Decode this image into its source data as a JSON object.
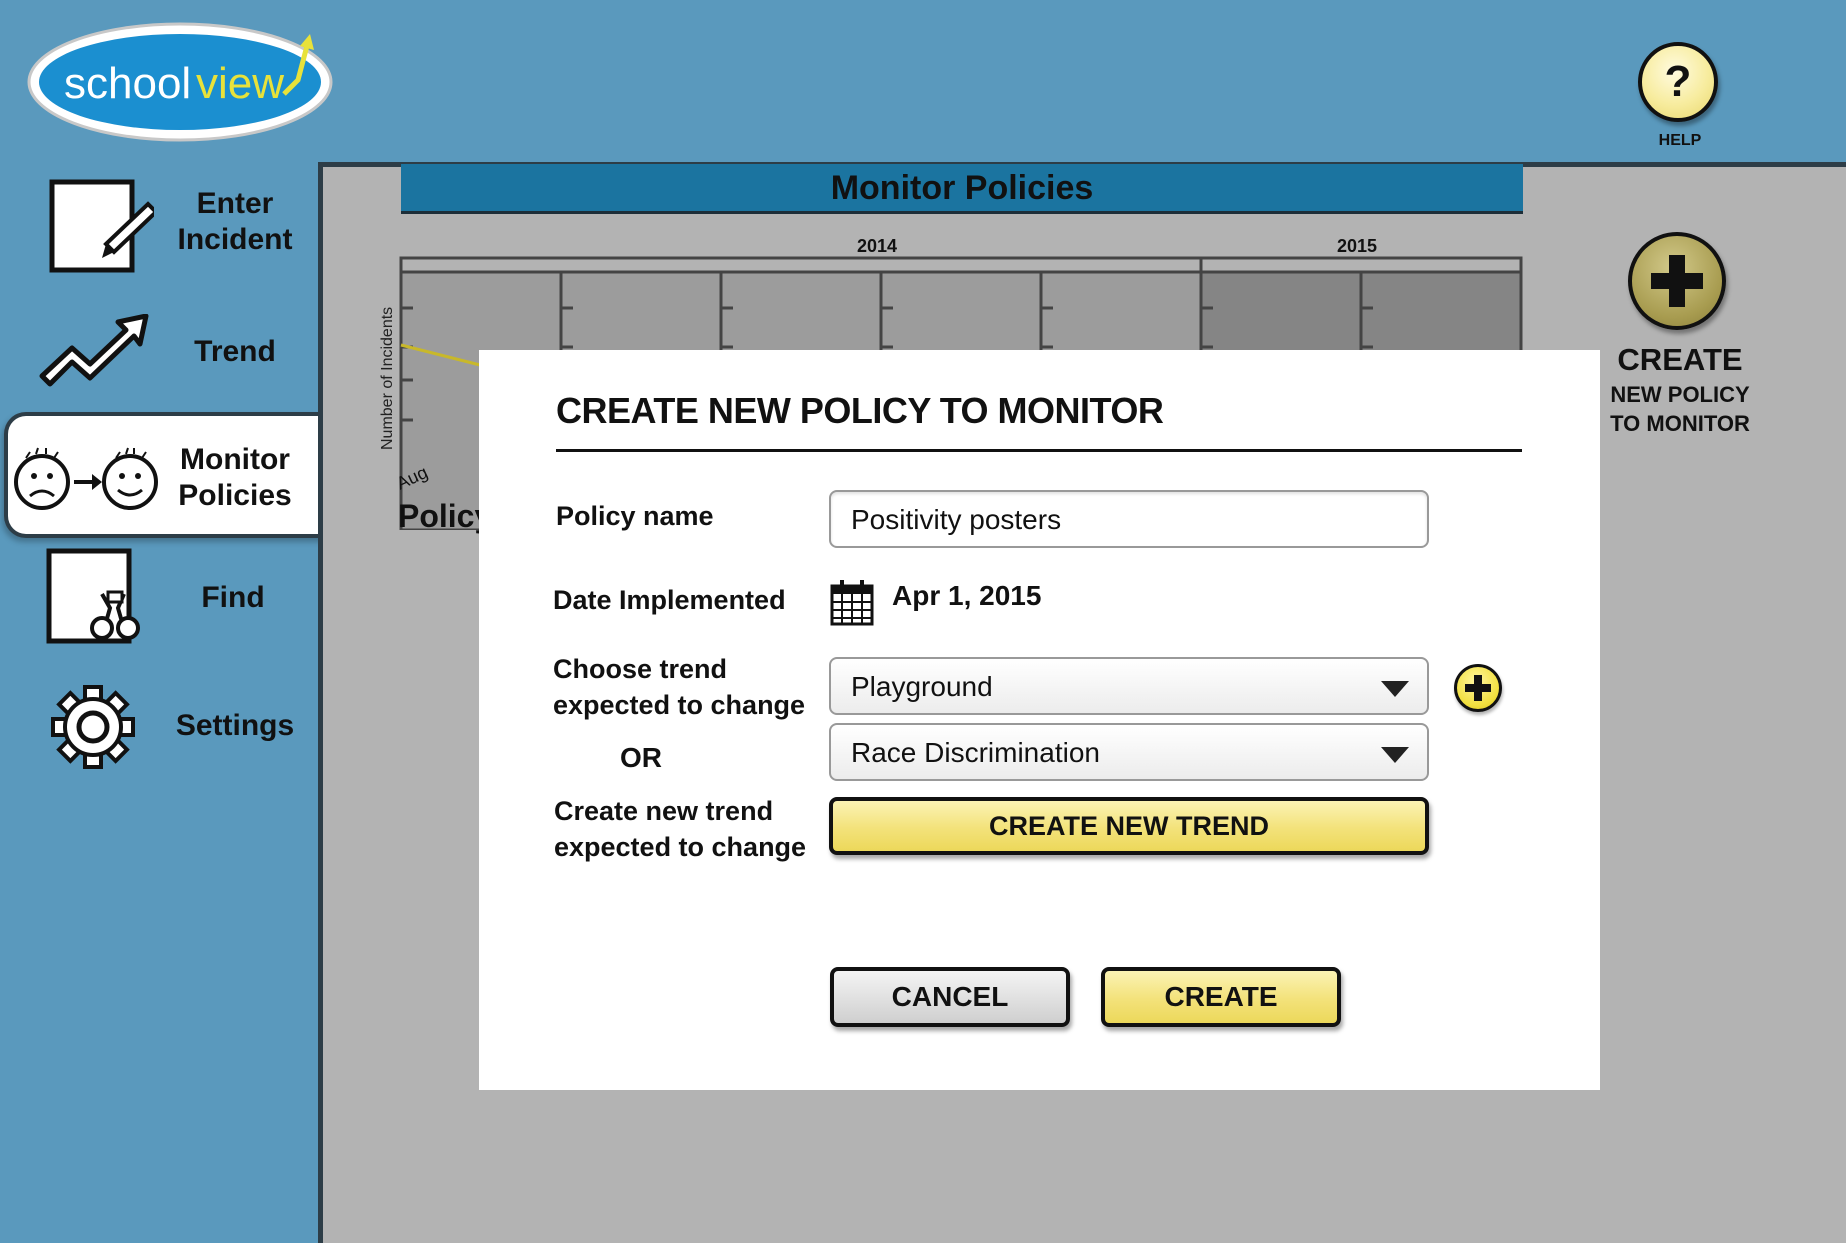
{
  "app": {
    "logo_text_school": "school",
    "logo_text_view": "view"
  },
  "help": {
    "label": "HELP",
    "glyph": "?"
  },
  "sidebar": {
    "items": [
      {
        "label_line1": "Enter",
        "label_line2": "Incident",
        "icon": "pencil-note-icon"
      },
      {
        "label_line1": "Trend",
        "label_line2": "",
        "icon": "trend-arrow-icon"
      },
      {
        "label_line1": "Monitor",
        "label_line2": "Policies",
        "icon": "sad-to-happy-icon",
        "active": true
      },
      {
        "label_line1": "Find",
        "label_line2": "",
        "icon": "binoculars-icon"
      },
      {
        "label_line1": "Settings",
        "label_line2": "",
        "icon": "gear-icon"
      }
    ]
  },
  "main": {
    "title": "Monitor Policies",
    "chart": {
      "year_labels": [
        "2014",
        "2015"
      ],
      "ylabel": "Number of Incidents",
      "first_month": "Aug",
      "policy_heading_partial": "Policy"
    },
    "create_side": {
      "line1": "CREATE",
      "line2": "NEW POLICY",
      "line3": "TO MONITOR"
    }
  },
  "modal": {
    "title": "CREATE NEW POLICY TO MONITOR",
    "policy_name_label": "Policy name",
    "policy_name_value": "Positivity posters",
    "date_label": "Date Implemented",
    "date_value": "Apr 1, 2015",
    "choose_trend_label_1": "Choose trend",
    "choose_trend_label_2": "expected to change",
    "trend_select_1": "Playground",
    "trend_select_2": "Race Discrimination",
    "or_label": "OR",
    "create_trend_label_1": "Create new trend",
    "create_trend_label_2": "expected to change",
    "create_new_trend_button": "CREATE NEW TREND",
    "cancel_button": "CANCEL",
    "create_button": "CREATE"
  },
  "colors": {
    "background": "#5a99bd",
    "title_bar": "#1b74a0",
    "panel": "#b3b3b3",
    "accent_yellow": "#f3e27a"
  }
}
